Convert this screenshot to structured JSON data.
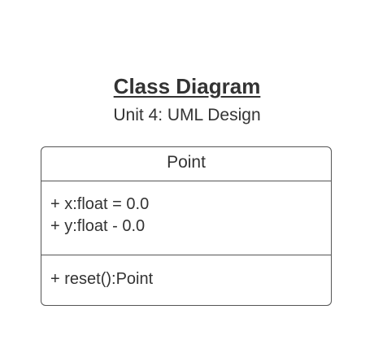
{
  "diagram": {
    "title": "Class Diagram",
    "subtitle": "Unit 4: UML Design",
    "class": {
      "name": "Point",
      "attributes": [
        "+ x:float = 0.0",
        "+ y:float - 0.0"
      ],
      "methods": [
        "+ reset():Point"
      ]
    }
  }
}
